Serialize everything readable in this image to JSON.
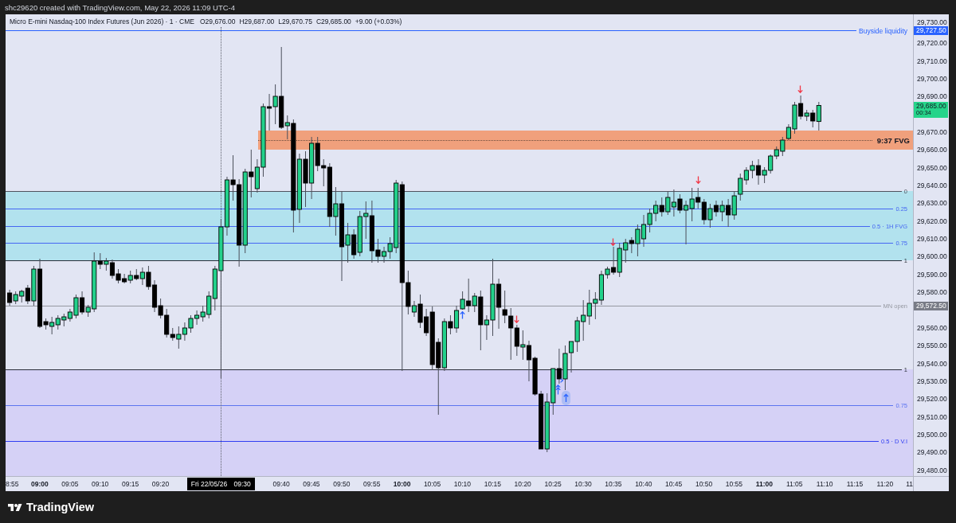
{
  "header": {
    "caption": "shc29620 created with TradingView.com, May 22, 2026 11:09 UTC-4"
  },
  "legend": {
    "title": "Micro E-mini Nasdaq-100 Index Futures (Jun 2026) · 1 · CME",
    "values": [
      "O29,676.00",
      "H29,687.00",
      "L29,670.75",
      "C29,685.00",
      "+9.00 (+0.03%)"
    ]
  },
  "chart": {
    "lines": [
      {
        "label": "Buyside liquidity",
        "color": "#2962ff",
        "tag": "29,727.50"
      },
      {
        "label": "MN open",
        "color": "#9598a1"
      }
    ],
    "fvg": {
      "label": "9:37 FVG"
    },
    "fib_zones": [
      {
        "color": "#b2e2ee",
        "levels": [
          {
            "label": "0",
            "color": "#50535e"
          },
          {
            "label": "0.25",
            "color": "#4566f2"
          },
          {
            "label": "0.5 · 1H FVG",
            "color": "#4566f2"
          },
          {
            "label": "0.75",
            "color": "#4566f2"
          },
          {
            "label": "1",
            "color": "#2a2e39"
          }
        ]
      },
      {
        "color": "#d5d1f6",
        "levels": [
          {
            "label": "1",
            "color": "#2a2e39"
          },
          {
            "label": "0.75",
            "color": "#5b74f0"
          },
          {
            "label": "0.5 · D V.I",
            "color": "#2f3df2"
          }
        ]
      }
    ]
  },
  "price_axis": [
    {
      "kind": "tick",
      "label": "29,730.00"
    },
    {
      "kind": "tick",
      "label": "29,720.00"
    },
    {
      "kind": "tick",
      "label": "29,710.00"
    },
    {
      "kind": "tick",
      "label": "29,700.00"
    },
    {
      "kind": "tick",
      "label": "29,690.00"
    },
    {
      "kind": "live",
      "price": "29,685.00",
      "countdown": "00:34"
    },
    {
      "kind": "tick",
      "label": "29,670.00"
    },
    {
      "kind": "tick",
      "label": "29,660.00"
    },
    {
      "kind": "tick",
      "label": "29,650.00"
    },
    {
      "kind": "tick",
      "label": "29,640.00"
    },
    {
      "kind": "tick",
      "label": "29,630.00"
    },
    {
      "kind": "tick",
      "label": "29,620.00"
    },
    {
      "kind": "tick",
      "label": "29,610.00"
    },
    {
      "kind": "tick",
      "label": "29,600.00"
    },
    {
      "kind": "tick",
      "label": "29,590.00"
    },
    {
      "kind": "tick",
      "label": "29,580.00"
    },
    {
      "kind": "tag",
      "label": "29,572.50"
    },
    {
      "kind": "tick",
      "label": "29,560.00"
    },
    {
      "kind": "tick",
      "label": "29,550.00"
    },
    {
      "kind": "tick",
      "label": "29,540.00"
    },
    {
      "kind": "tick",
      "label": "29,530.00"
    },
    {
      "kind": "tick",
      "label": "29,520.00"
    },
    {
      "kind": "tick",
      "label": "29,510.00"
    },
    {
      "kind": "tick",
      "label": "29,500.00"
    },
    {
      "kind": "tick",
      "label": "29,490.00"
    },
    {
      "kind": "tick",
      "label": "29,480.00"
    }
  ],
  "time_axis": [
    {
      "kind": "minute",
      "label": "8:55"
    },
    {
      "kind": "hour",
      "label": "09:00"
    },
    {
      "kind": "minute",
      "label": "09:05"
    },
    {
      "kind": "minute",
      "label": "09:10"
    },
    {
      "kind": "minute",
      "label": "09:15"
    },
    {
      "kind": "minute",
      "label": "09:20"
    },
    {
      "kind": "crosshair",
      "date": "Fri 22/05/26",
      "time": "09:30"
    },
    {
      "kind": "minute",
      "label": "09:40"
    },
    {
      "kind": "minute",
      "label": "09:45"
    },
    {
      "kind": "minute",
      "label": "09:50"
    },
    {
      "kind": "minute",
      "label": "09:55"
    },
    {
      "kind": "hour",
      "label": "10:00"
    },
    {
      "kind": "minute",
      "label": "10:05"
    },
    {
      "kind": "minute",
      "label": "10:10"
    },
    {
      "kind": "minute",
      "label": "10:15"
    },
    {
      "kind": "minute",
      "label": "10:20"
    },
    {
      "kind": "minute",
      "label": "10:25"
    },
    {
      "kind": "minute",
      "label": "10:30"
    },
    {
      "kind": "minute",
      "label": "10:35"
    },
    {
      "kind": "minute",
      "label": "10:40"
    },
    {
      "kind": "minute",
      "label": "10:45"
    },
    {
      "kind": "minute",
      "label": "10:50"
    },
    {
      "kind": "minute",
      "label": "10:55"
    },
    {
      "kind": "hour",
      "label": "11:00"
    },
    {
      "kind": "minute",
      "label": "11:05"
    },
    {
      "kind": "minute",
      "label": "11:10"
    },
    {
      "kind": "minute",
      "label": "11:15"
    },
    {
      "kind": "minute",
      "label": "11:20"
    },
    {
      "kind": "minute",
      "label": "11"
    }
  ],
  "footer": {
    "brand": "TradingView"
  }
}
